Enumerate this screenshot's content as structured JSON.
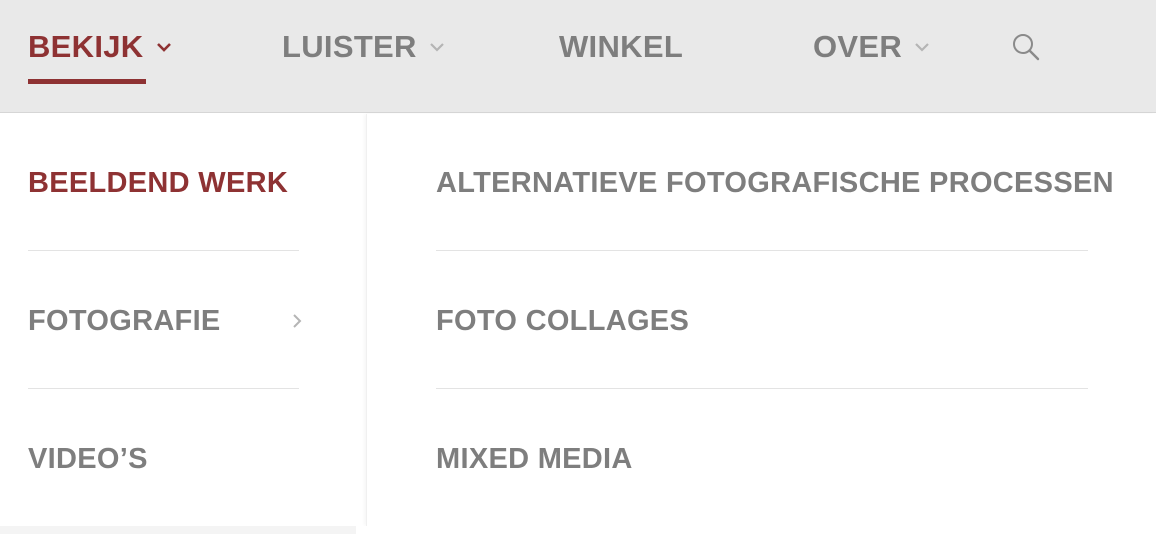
{
  "nav": {
    "items": [
      {
        "label": "BEKIJK",
        "active": true,
        "has_dropdown": true
      },
      {
        "label": "LUISTER",
        "active": false,
        "has_dropdown": true
      },
      {
        "label": "WINKEL",
        "active": false,
        "has_dropdown": false
      },
      {
        "label": "OVER",
        "active": false,
        "has_dropdown": true
      }
    ],
    "search_icon": "search-icon"
  },
  "menu": {
    "left": [
      {
        "label": "BEELDEND WERK",
        "active": true
      },
      {
        "label": "FOTOGRAFIE",
        "active": false,
        "has_submenu": true
      },
      {
        "label": "VIDEO’S",
        "active": false
      }
    ],
    "right": [
      {
        "label": "ALTERNATIEVE FOTOGRAFISCHE PROCESSEN"
      },
      {
        "label": "FOTO COLLAGES"
      },
      {
        "label": "MIXED MEDIA"
      }
    ]
  },
  "colors": {
    "accent": "#8e3233",
    "text_gray": "#7e7e7e",
    "topbar_bg": "#e9e9e9"
  }
}
